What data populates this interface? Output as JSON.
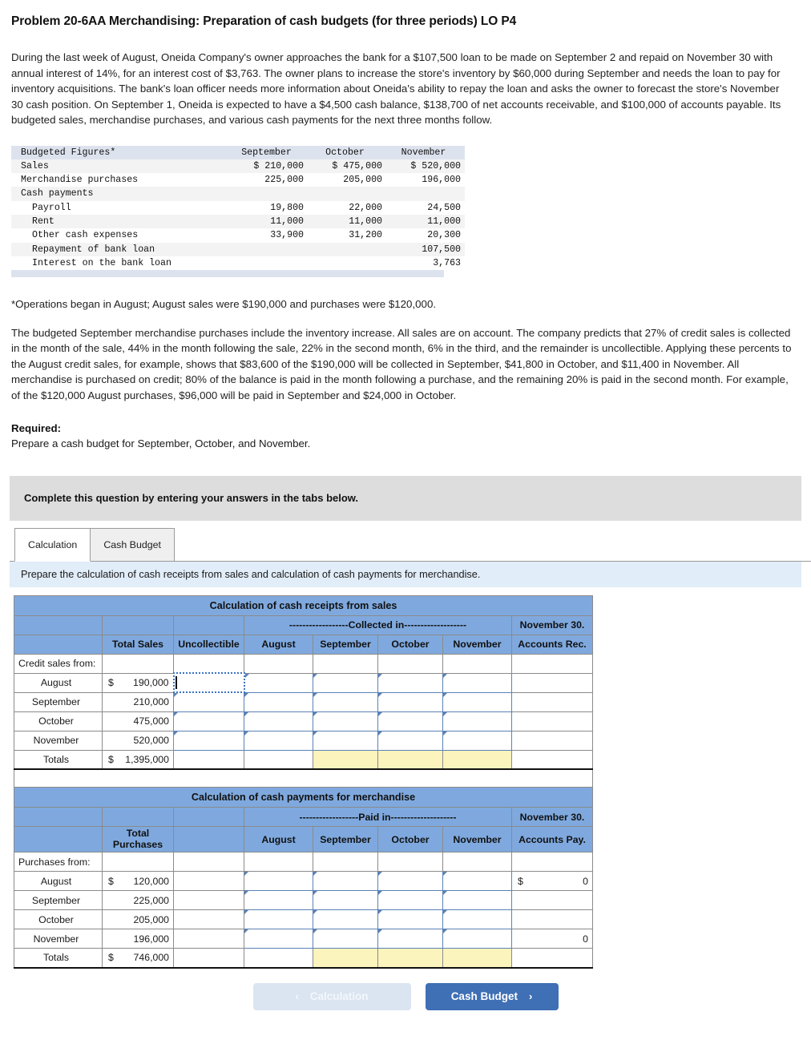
{
  "title": "Problem 20-6AA Merchandising: Preparation of cash budgets (for three periods) LO P4",
  "narrative": {
    "paragraph1": "During the last week of August, Oneida Company's owner approaches the bank for a $107,500 loan to be made on September 2 and repaid on November 30 with annual interest of 14%, for an interest cost of $3,763. The owner plans to increase the store's inventory by $60,000 during September and needs the loan to pay for inventory acquisitions. The bank's loan officer needs more information about Oneida's ability to repay the loan and asks the owner to forecast the store's November 30 cash position. On September 1, Oneida is expected to have a $4,500 cash balance, $138,700 of net accounts receivable, and $100,000 of accounts payable. Its budgeted sales, merchandise purchases, and various cash payments for the next three months follow.",
    "footnote": "*Operations began in August; August sales were $190,000 and purchases were $120,000.",
    "paragraph2": "The budgeted September merchandise purchases include the inventory increase. All sales are on account. The company predicts that 27% of credit sales is collected in the month of the sale, 44% in the month following the sale, 22% in the second month, 6% in the third, and the remainder is uncollectible. Applying these percents to the August credit sales, for example, shows that $83,600 of the $190,000 will be collected in September, $41,800 in October, and $11,400 in November. All merchandise is purchased on credit; 80% of the balance is paid in the month following a purchase, and the remaining 20% is paid in the second month. For example, of the $120,000 August purchases, $96,000 will be paid in September and $24,000 in October.",
    "required_label": "Required:",
    "required_text": "Prepare a cash budget for September, October, and November."
  },
  "budget_figures": {
    "header": [
      "Budgeted Figures*",
      "September",
      "October",
      "November"
    ],
    "rows": [
      {
        "label": "Sales",
        "sep": "$ 210,000",
        "oct": "$ 475,000",
        "nov": "$ 520,000"
      },
      {
        "label": "Merchandise purchases",
        "sep": "225,000",
        "oct": "205,000",
        "nov": "196,000"
      },
      {
        "label": "Cash payments",
        "sep": "",
        "oct": "",
        "nov": ""
      },
      {
        "label": "Payroll",
        "sep": "19,800",
        "oct": "22,000",
        "nov": "24,500",
        "indent": true
      },
      {
        "label": "Rent",
        "sep": "11,000",
        "oct": "11,000",
        "nov": "11,000",
        "indent": true
      },
      {
        "label": "Other cash expenses",
        "sep": "33,900",
        "oct": "31,200",
        "nov": "20,300",
        "indent": true
      },
      {
        "label": "Repayment of bank loan",
        "sep": "",
        "oct": "",
        "nov": "107,500",
        "indent": true
      },
      {
        "label": "Interest on the bank loan",
        "sep": "",
        "oct": "",
        "nov": "3,763",
        "indent": true
      }
    ]
  },
  "gray_banner": "Complete this question by entering your answers in the tabs below.",
  "tabs": [
    {
      "label": "Calculation",
      "active": true
    },
    {
      "label": "Cash Budget",
      "active": false
    }
  ],
  "blue_bar": "Prepare the calculation of cash receipts from sales and calculation of cash payments for merchandise.",
  "receipts_table": {
    "title": "Calculation of cash receipts from sales",
    "group_header": "------------------Collected in-------------------",
    "last_col_top": "November 30.",
    "columns": [
      "",
      "Total Sales",
      "Uncollectible",
      "August",
      "September",
      "October",
      "November",
      "Accounts Rec."
    ],
    "section_label": "Credit sales from:",
    "rows": [
      {
        "label": "August",
        "dollar": "$",
        "total": "190,000"
      },
      {
        "label": "September",
        "dollar": "",
        "total": "210,000"
      },
      {
        "label": "October",
        "dollar": "",
        "total": "475,000"
      },
      {
        "label": "November",
        "dollar": "",
        "total": "520,000"
      }
    ],
    "totals": {
      "label": "Totals",
      "dollar": "$",
      "total": "1,395,000"
    }
  },
  "payments_table": {
    "title": "Calculation of cash payments for merchandise",
    "group_header": "------------------Paid in--------------------",
    "last_col_top": "November 30.",
    "columns": [
      "",
      "Total Purchases",
      "",
      "August",
      "September",
      "October",
      "November",
      "Accounts Pay."
    ],
    "section_label": "Purchases from:",
    "rows": [
      {
        "label": "August",
        "dollar": "$",
        "total": "120,000",
        "ap_dollar": "$",
        "ap": "0"
      },
      {
        "label": "September",
        "dollar": "",
        "total": "225,000",
        "ap_dollar": "",
        "ap": ""
      },
      {
        "label": "October",
        "dollar": "",
        "total": "205,000",
        "ap_dollar": "",
        "ap": ""
      },
      {
        "label": "November",
        "dollar": "",
        "total": "196,000",
        "ap_dollar": "",
        "ap": "0"
      }
    ],
    "totals": {
      "label": "Totals",
      "dollar": "$",
      "total": "746,000"
    }
  },
  "nav": {
    "prev_label": "Calculation",
    "next_label": "Cash Budget",
    "prev_chevron": "‹",
    "next_chevron": "›"
  },
  "colors": {
    "header_blue": "#7fa9de",
    "instruction_blue": "#e1edf8",
    "banner_gray": "#dddddd",
    "highlight_yellow": "#fbf4bd",
    "input_border": "#5b82b5",
    "btn_primary": "#3f6fb5",
    "btn_disabled": "#dbe5f1"
  }
}
